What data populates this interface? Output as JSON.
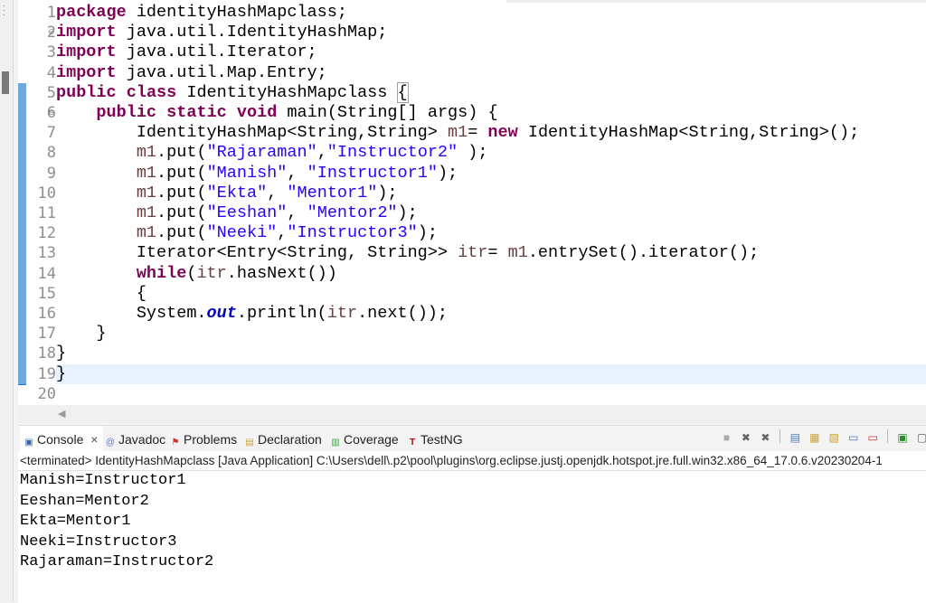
{
  "editor": {
    "lines": [
      {
        "n": "1",
        "fold": false,
        "tokens": [
          [
            "kw",
            "package"
          ],
          [
            "",
            "identityHashMapclass;"
          ]
        ]
      },
      {
        "n": "2",
        "fold": true,
        "tokens": [
          [
            "kw",
            "import"
          ],
          [
            "",
            " java.util.IdentityHashMap;"
          ]
        ]
      },
      {
        "n": "3",
        "fold": false,
        "tokens": [
          [
            "kw",
            "import"
          ],
          [
            "",
            " java.util.Iterator;"
          ]
        ]
      },
      {
        "n": "4",
        "fold": false,
        "tokens": [
          [
            "kw",
            "import"
          ],
          [
            "",
            " java.util.Map.Entry;"
          ]
        ]
      },
      {
        "n": "5",
        "fold": false,
        "tokens": [
          [
            "kw",
            "public"
          ],
          [
            "",
            " "
          ],
          [
            "kw",
            "class"
          ],
          [
            "",
            " IdentityHashMapclass "
          ],
          [
            "brk",
            "{"
          ]
        ]
      },
      {
        "n": "6",
        "fold": true,
        "tokens": [
          [
            "",
            "    "
          ],
          [
            "kw",
            "public"
          ],
          [
            "",
            " "
          ],
          [
            "kw",
            "static"
          ],
          [
            "",
            " "
          ],
          [
            "kw",
            "void"
          ],
          [
            "",
            " main(String[] args) {"
          ]
        ]
      },
      {
        "n": "7",
        "fold": false,
        "tokens": [
          [
            "",
            "        IdentityHashMap<String,String> "
          ],
          [
            "var",
            "m1"
          ],
          [
            "",
            "= "
          ],
          [
            "kw",
            "new"
          ],
          [
            "",
            " IdentityHashMap<String,String>();"
          ]
        ]
      },
      {
        "n": "8",
        "fold": false,
        "tokens": [
          [
            "",
            "        "
          ],
          [
            "var",
            "m1"
          ],
          [
            "",
            ".put("
          ],
          [
            "str",
            "\"Rajaraman\""
          ],
          [
            "",
            ","
          ],
          [
            "str",
            "\"Instructor2\""
          ],
          [
            "",
            " );"
          ]
        ]
      },
      {
        "n": "9",
        "fold": false,
        "tokens": [
          [
            "",
            "        "
          ],
          [
            "var",
            "m1"
          ],
          [
            "",
            ".put("
          ],
          [
            "str",
            "\"Manish\""
          ],
          [
            "",
            ", "
          ],
          [
            "str",
            "\"Instructor1\""
          ],
          [
            "",
            ");"
          ]
        ]
      },
      {
        "n": "10",
        "fold": false,
        "tokens": [
          [
            "",
            "        "
          ],
          [
            "var",
            "m1"
          ],
          [
            "",
            ".put("
          ],
          [
            "str",
            "\"Ekta\""
          ],
          [
            "",
            ", "
          ],
          [
            "str",
            "\"Mentor1\""
          ],
          [
            "",
            ");"
          ]
        ]
      },
      {
        "n": "11",
        "fold": false,
        "tokens": [
          [
            "",
            "        "
          ],
          [
            "var",
            "m1"
          ],
          [
            "",
            ".put("
          ],
          [
            "str",
            "\"Eeshan\""
          ],
          [
            "",
            ", "
          ],
          [
            "str",
            "\"Mentor2\""
          ],
          [
            "",
            ");"
          ]
        ]
      },
      {
        "n": "12",
        "fold": false,
        "tokens": [
          [
            "",
            "        "
          ],
          [
            "var",
            "m1"
          ],
          [
            "",
            ".put("
          ],
          [
            "str",
            "\"Neeki\""
          ],
          [
            "",
            ","
          ],
          [
            "str",
            "\"Instructor3\""
          ],
          [
            "",
            ");"
          ]
        ]
      },
      {
        "n": "13",
        "fold": false,
        "tokens": [
          [
            "",
            "        Iterator<Entry<String, String>> "
          ],
          [
            "var",
            "itr"
          ],
          [
            "",
            "= "
          ],
          [
            "var",
            "m1"
          ],
          [
            "",
            ".entrySet().iterator();"
          ]
        ]
      },
      {
        "n": "14",
        "fold": false,
        "tokens": [
          [
            "",
            "        "
          ],
          [
            "kw",
            "while"
          ],
          [
            "",
            "("
          ],
          [
            "var",
            "itr"
          ],
          [
            "",
            ".hasNext())"
          ]
        ]
      },
      {
        "n": "15",
        "fold": false,
        "tokens": [
          [
            "",
            "        {"
          ]
        ]
      },
      {
        "n": "16",
        "fold": false,
        "tokens": [
          [
            "",
            "        System."
          ],
          [
            "fld",
            "out"
          ],
          [
            "",
            ".println("
          ],
          [
            "var",
            "itr"
          ],
          [
            "",
            ".next());"
          ]
        ]
      },
      {
        "n": "17",
        "fold": false,
        "tokens": [
          [
            "",
            "    }"
          ]
        ]
      },
      {
        "n": "18",
        "fold": false,
        "tokens": [
          [
            "",
            "}"
          ]
        ]
      },
      {
        "n": "19",
        "fold": false,
        "tokens": [
          [
            "",
            "}"
          ]
        ]
      },
      {
        "n": "20",
        "fold": false,
        "tokens": []
      }
    ]
  },
  "panel": {
    "tabs": [
      {
        "label": "Console",
        "icon": "console-icon",
        "active": true,
        "closable": true
      },
      {
        "label": "Javadoc",
        "icon": "javadoc-icon"
      },
      {
        "label": "Problems",
        "icon": "problems-icon"
      },
      {
        "label": "Declaration",
        "icon": "declaration-icon"
      },
      {
        "label": "Coverage",
        "icon": "coverage-icon"
      },
      {
        "label": "TestNG",
        "icon": "testng-icon"
      }
    ],
    "close_glyph": "×",
    "path": "<terminated> IdentityHashMapclass [Java Application] C:\\Users\\dell\\.p2\\pool\\plugins\\org.eclipse.justj.openjdk.hotspot.jre.full.win32.x86_64_17.0.6.v20230204-1",
    "output": [
      "Manish=Instructor1",
      "Eeshan=Mentor2",
      "Ekta=Mentor1",
      "Neeki=Instructor3",
      "Rajaraman=Instructor2"
    ]
  }
}
